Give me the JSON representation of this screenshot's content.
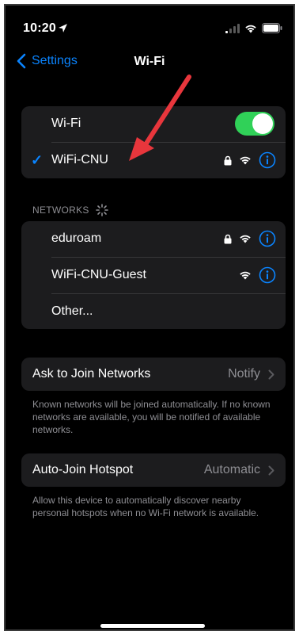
{
  "status": {
    "time": "10:20"
  },
  "nav": {
    "back_label": "Settings",
    "title": "Wi-Fi"
  },
  "wifi_toggle": {
    "label": "Wi-Fi",
    "on": true
  },
  "connected": {
    "name": "WiFi-CNU",
    "checkmark": "✓"
  },
  "networks": {
    "header": "NETWORKS",
    "items": [
      {
        "name": "eduroam",
        "locked": true
      },
      {
        "name": "WiFi-CNU-Guest",
        "locked": false
      },
      {
        "name": "Other..."
      }
    ]
  },
  "ask_to_join": {
    "label": "Ask to Join Networks",
    "value": "Notify",
    "footer": "Known networks will be joined automatically. If no known networks are available, you will be notified of available networks."
  },
  "auto_join": {
    "label": "Auto-Join Hotspot",
    "value": "Automatic",
    "footer": "Allow this device to automatically discover nearby personal hotspots when no Wi-Fi network is available."
  },
  "colors": {
    "accent": "#0a84ff",
    "toggle_on": "#30d158",
    "annotation_arrow": "#e8363c"
  },
  "icons": [
    "location-arrow-icon",
    "signal-icon",
    "wifi-icon",
    "battery-icon",
    "chevron-left-icon",
    "checkmark-icon",
    "lock-icon",
    "info-icon",
    "chevron-right-icon",
    "spinner-icon"
  ]
}
